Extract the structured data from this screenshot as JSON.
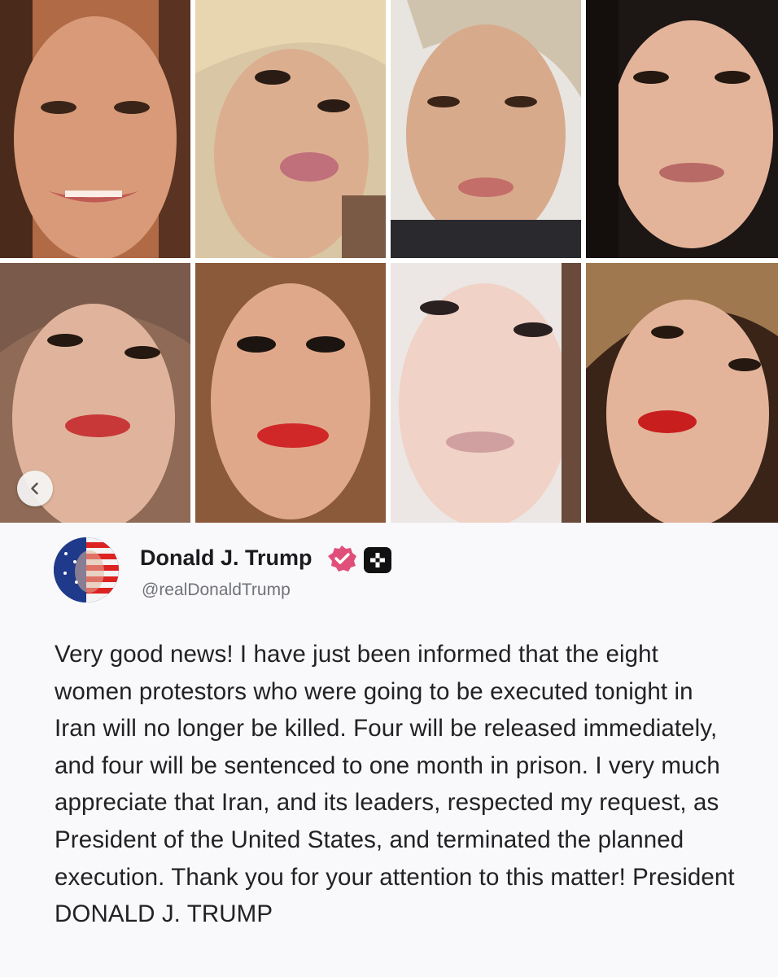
{
  "gallery": {
    "photo_count": 8,
    "prev_icon": "chevron-left-icon"
  },
  "post": {
    "author_name": "Donald J. Trump",
    "handle": "@realDonaldTrump",
    "verified_icon": "verified-badge-icon",
    "plus_icon": "plus-badge-icon",
    "accent_color": "#e04f7a",
    "text": "Very good news! I have just been informed that the eight women protestors who were going to be executed tonight in Iran will no longer be killed. Four will be released immediately, and four will be sentenced to one month in prison. I very much appreciate that Iran, and its leaders, respected my request, as President of the United States, and terminated the planned execution. Thank you for your attention to this matter! President DONALD J. TRUMP"
  }
}
